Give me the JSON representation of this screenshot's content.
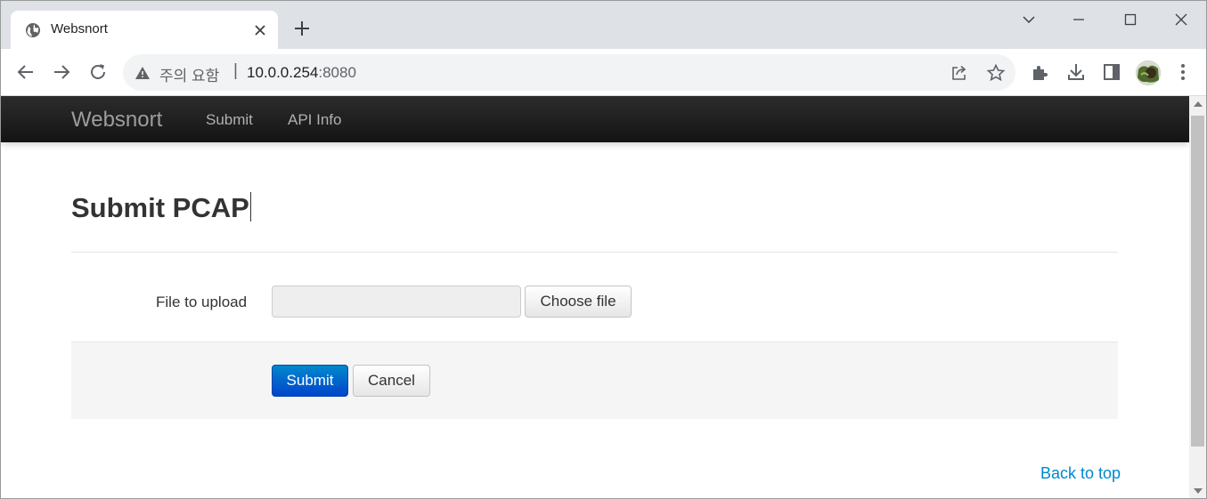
{
  "browser": {
    "tab": {
      "title": "Websnort",
      "favicon": "globe-icon"
    },
    "new_tab_icon": "plus-icon",
    "window_controls": [
      "chevron-down-icon",
      "minimize-icon",
      "maximize-icon",
      "close-icon"
    ],
    "address": {
      "security_warning": "주의 요함",
      "separator": "|",
      "host": "10.0.0.254",
      "port": ":8080"
    }
  },
  "navbar": {
    "brand": "Websnort",
    "links": [
      "Submit",
      "API Info"
    ]
  },
  "main": {
    "title": "Submit PCAP",
    "file_label": "File to upload",
    "choose_file": "Choose file",
    "submit": "Submit",
    "cancel": "Cancel",
    "back_to_top": "Back to top"
  },
  "colors": {
    "primary": "#0066cc",
    "navbar": "#1b1b1b",
    "link": "#0088cc"
  }
}
